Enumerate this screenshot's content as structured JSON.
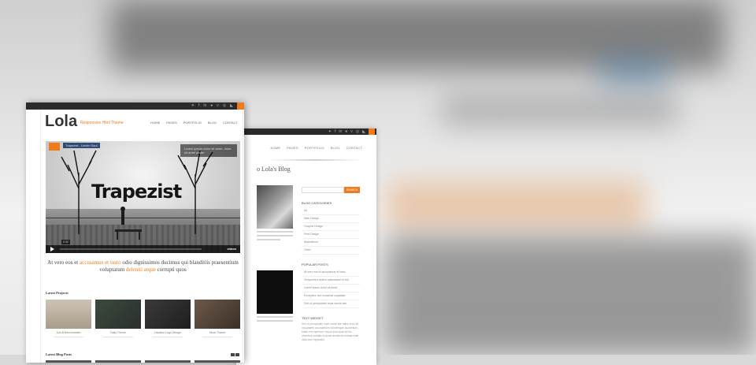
{
  "front": {
    "brand": {
      "logo": "Lola",
      "tagline": "Responsive Html Theme"
    },
    "nav": [
      "HOME",
      "PAGES",
      "PORTFOLIO",
      "BLOG",
      "CONTACT"
    ],
    "hero": {
      "word": "Trapezist",
      "video_title": "Trapezist - Urchin Soul",
      "caption": "Lorem ipsum dolor sit amet, dolor sit amet under",
      "time": "0:32",
      "player_brand": "vimeo"
    },
    "intro": {
      "p1": "At vero eos et ",
      "h1": "accusamus et iusto",
      "p2": " odio dignissimos ducimus qui blanditiis praesentium voluptatum ",
      "h2": "deleniti atque",
      "p3": " corrupti quos"
    },
    "latest_projects_label": "Latest Projects",
    "projects": [
      {
        "title": "Join B Benchmarker"
      },
      {
        "title": "Daily Theme"
      },
      {
        "title": "Havalon Logo Design"
      },
      {
        "title": "Moon Theme"
      }
    ],
    "latest_posts_label": "Latest Blog Posts"
  },
  "back": {
    "nav": [
      "HOME",
      "PAGES",
      "PORTFOLIO",
      "BLOG",
      "CONTACT"
    ],
    "blog_title": "o Lola's Blog",
    "search_button": "SEARCH",
    "categories_label": "BLOG CATEGORIES",
    "categories": [
      "All",
      "Web Design",
      "Graphic Design",
      "Print Design",
      "Illustrations",
      "Other"
    ],
    "popular_label": "POPULAR POSTS",
    "popular": [
      "At vero eos et accusamus et iusto",
      "Temporibus autem quibusdam et aut",
      "Lorem ipsum dolor sit amet",
      "Excepteur sint occaecat cupidatat",
      "Sed ut perspiciatis unde omnis iste"
    ],
    "text_widget_label": "TEXT WIDGET",
    "text_widget": "Sed ut perspiciatis unde omnis iste natus error sit voluptatem accusantium doloremque laudantium, totam rem aperiam, eaque ipsa quae ab illo inventore veritatis et quasi architecto beatae vitae dicta sunt explicabo."
  },
  "colors": {
    "accent": "#f07b1b",
    "topbar": "#2b2b2b"
  },
  "icons": [
    "twitter-icon",
    "facebook-icon",
    "linkedin-icon",
    "flickr-icon",
    "vimeo-icon",
    "dribbble-icon",
    "rss-icon"
  ]
}
